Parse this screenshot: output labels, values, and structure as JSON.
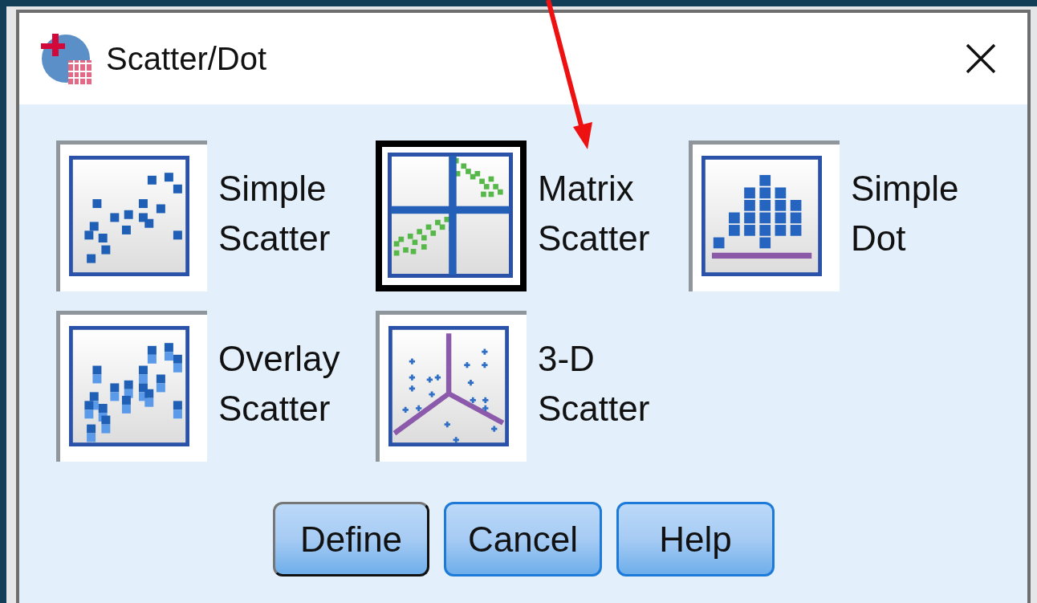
{
  "window": {
    "title": "Scatter/Dot"
  },
  "chart_types": [
    {
      "kind": "simple",
      "label": "Simple Scatter",
      "selected": false
    },
    {
      "kind": "matrix",
      "label": "Matrix Scatter",
      "selected": true
    },
    {
      "kind": "dot",
      "label": "Simple Dot",
      "selected": false
    },
    {
      "kind": "overlay",
      "label": "Overlay Scatter",
      "selected": false
    },
    {
      "kind": "threed",
      "label": "3-D Scatter",
      "selected": false
    }
  ],
  "buttons": [
    {
      "label": "Define",
      "default": true
    },
    {
      "label": "Cancel",
      "default": false
    },
    {
      "label": "Help",
      "default": false
    }
  ]
}
